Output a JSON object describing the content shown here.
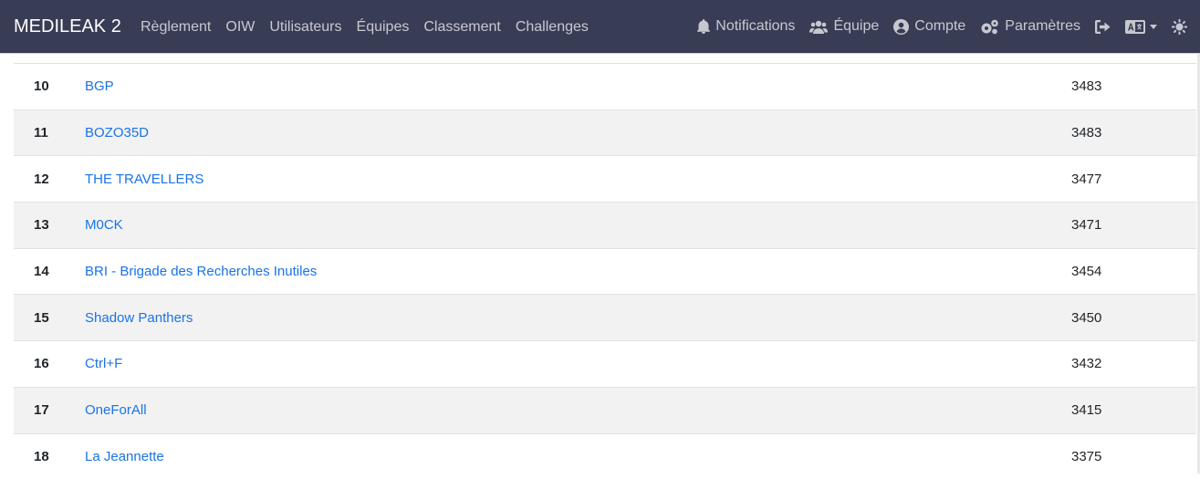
{
  "nav": {
    "brand": "MEDILEAK 2",
    "links": [
      "Règlement",
      "OIW",
      "Utilisateurs",
      "Équipes",
      "Classement",
      "Challenges"
    ],
    "notifications": "Notifications",
    "team": "Équipe",
    "account": "Compte",
    "settings": "Paramètres"
  },
  "icons": {
    "notifications": "bell-icon",
    "team": "users-icon",
    "account": "user-circle-icon",
    "settings": "cogs-icon",
    "logout": "sign-out-icon",
    "language": "language-icon",
    "theme": "sun-icon"
  },
  "colors": {
    "navbar": "#383c55",
    "link": "#1a73e8",
    "row_alt": "#f2f2f2"
  },
  "scoreboard": {
    "rows": [
      {
        "rank": "10",
        "team": "BGP",
        "score": "3483"
      },
      {
        "rank": "11",
        "team": "BOZO35D",
        "score": "3483"
      },
      {
        "rank": "12",
        "team": "THE TRAVELLERS",
        "score": "3477"
      },
      {
        "rank": "13",
        "team": "M0CK",
        "score": "3471"
      },
      {
        "rank": "14",
        "team": "BRI - Brigade des Recherches Inutiles",
        "score": "3454"
      },
      {
        "rank": "15",
        "team": "Shadow Panthers",
        "score": "3450"
      },
      {
        "rank": "16",
        "team": "Ctrl+F",
        "score": "3432"
      },
      {
        "rank": "17",
        "team": "OneForAll",
        "score": "3415"
      },
      {
        "rank": "18",
        "team": "La Jeannette",
        "score": "3375"
      }
    ]
  }
}
